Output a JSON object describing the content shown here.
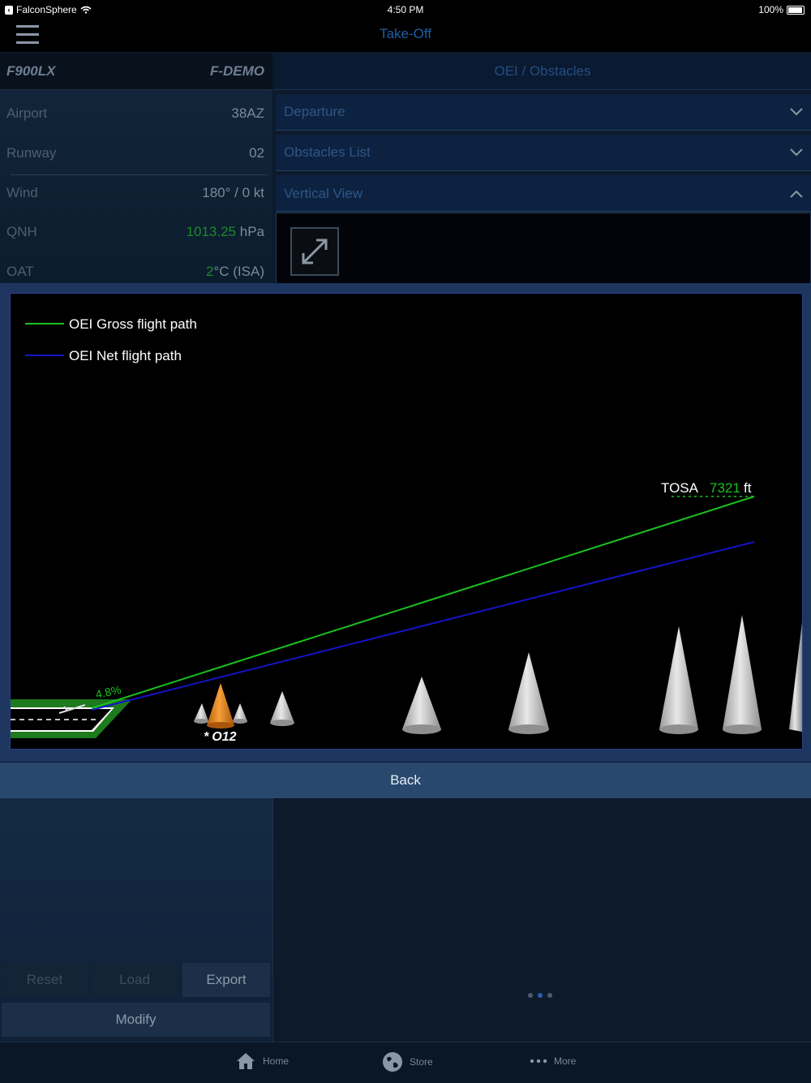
{
  "status_bar": {
    "carrier": "FalconSphere",
    "time": "4:50 PM",
    "battery": "100%"
  },
  "nav": {
    "title": "Take-Off"
  },
  "aircraft": {
    "type": "F900LX",
    "registration": "F-DEMO"
  },
  "params": [
    {
      "label": "Airport",
      "value": "38AZ",
      "highlight": "",
      "unit": ""
    },
    {
      "label": "Runway",
      "value": "02",
      "highlight": "",
      "unit": ""
    },
    {
      "label": "Wind",
      "value": "180° / 0 kt",
      "highlight": "",
      "unit": ""
    },
    {
      "label": "QNH",
      "value": "",
      "highlight": "1013.25",
      "unit": " hPa"
    },
    {
      "label": "OAT",
      "value": "",
      "highlight": "2",
      "unit": "°C (ISA)"
    }
  ],
  "right_panel": {
    "title": "OEI / Obstacles",
    "sections": [
      "Departure",
      "Obstacles List",
      "Vertical View"
    ]
  },
  "chart_data": {
    "type": "line",
    "title": "",
    "xlabel": "",
    "ylabel": "",
    "series": [
      {
        "name": "OEI Gross flight path",
        "color": "#19c21f",
        "gradient_label": "4.8%"
      },
      {
        "name": "OEI Net flight path",
        "color": "#1414c8"
      }
    ],
    "tosa": {
      "label": "TOSA",
      "value": "7321",
      "unit": "ft"
    },
    "critical_obstacle": {
      "label": "O12",
      "marker": "*",
      "color": "#e8871e"
    },
    "legend_position": "top-left",
    "grid": false
  },
  "back_label": "Back",
  "buttons": {
    "reset": "Reset",
    "load": "Load",
    "export": "Export",
    "modify": "Modify"
  },
  "tabs": [
    {
      "label": "Home",
      "icon": "home-icon"
    },
    {
      "label": "Store",
      "icon": "globe-icon"
    },
    {
      "label": "More",
      "icon": "more-icon"
    }
  ]
}
